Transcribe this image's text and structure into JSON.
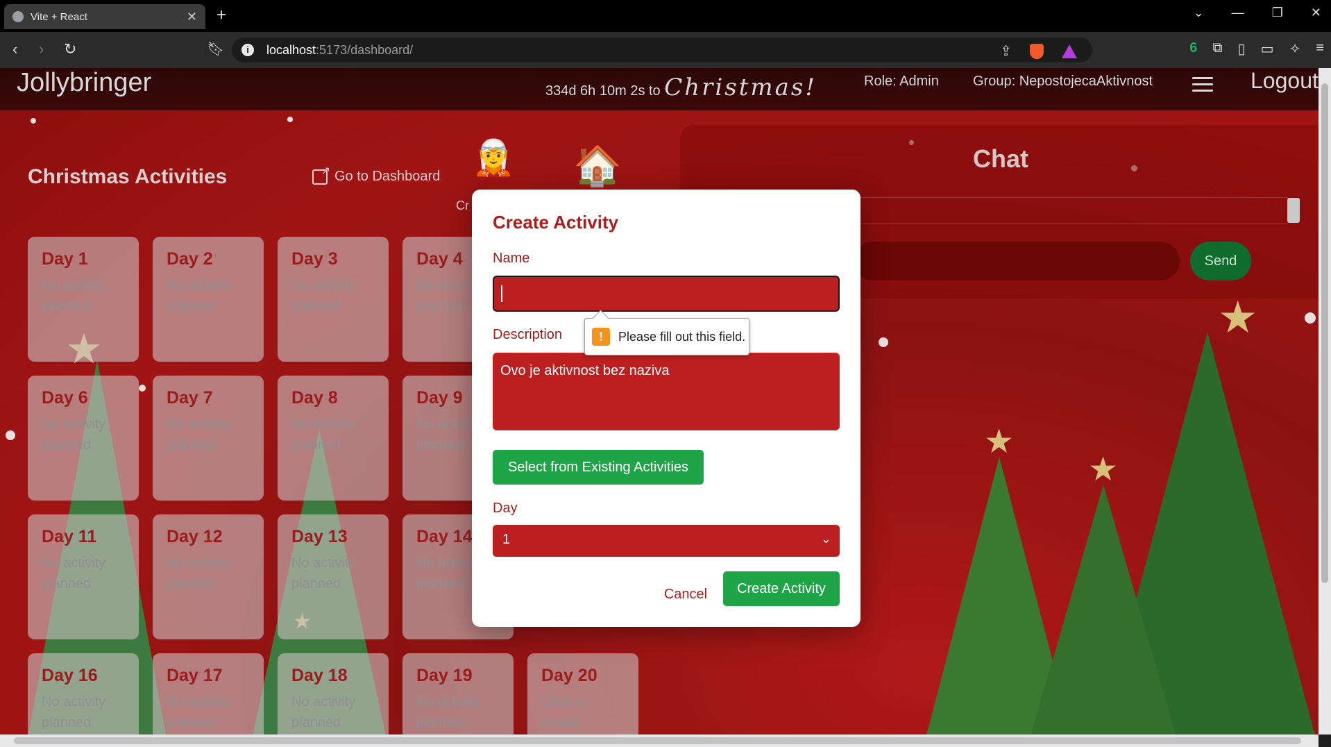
{
  "browser": {
    "tab_title": "Vite + React",
    "url_host": "localhost",
    "url_path": ":5173/dashboard/",
    "extension_badge": "6"
  },
  "navbar": {
    "brand": "Jollybringer",
    "countdown_prefix": "334d 6h 10m 2s to",
    "countdown_word": "Christmas!",
    "role": "Role: Admin",
    "group": "Group: NepostojecaAktivnost",
    "logout": "Logout"
  },
  "activities": {
    "title": "Christmas Activities",
    "goto_dashboard": "Go to Dashboard",
    "cr_fragment": "Cr",
    "days": [
      {
        "day": "Day 1",
        "status": "No activity planned"
      },
      {
        "day": "Day 2",
        "status": "No activity planned"
      },
      {
        "day": "Day 3",
        "status": "No activity planned"
      },
      {
        "day": "Day 4",
        "status": "No activi planned"
      },
      {
        "day": "Day 6",
        "status": "No activity planned"
      },
      {
        "day": "Day 7",
        "status": "No activity planned"
      },
      {
        "day": "Day 8",
        "status": "No activity planned"
      },
      {
        "day": "Day 9",
        "status": "No activi planned"
      },
      {
        "day": "Day 11",
        "status": "No activity planned"
      },
      {
        "day": "Day 12",
        "status": "No activity planned"
      },
      {
        "day": "Day 13",
        "status": "No activity planned"
      },
      {
        "day": "Day 14",
        "status": "No activi planned"
      },
      {
        "day": "Day 16",
        "status": "No activity planned"
      },
      {
        "day": "Day 17",
        "status": "No activity planned"
      },
      {
        "day": "Day 18",
        "status": "No activity planned"
      },
      {
        "day": "Day 19",
        "status": "No activity planned"
      },
      {
        "day": "Day 20",
        "status": "Click to reveal"
      }
    ]
  },
  "chat": {
    "title": "Chat",
    "send_label": "Send"
  },
  "modal": {
    "title": "Create Activity",
    "name_label": "Name",
    "name_value": "",
    "description_label": "Description",
    "description_value": "Ovo je aktivnost bez naziva",
    "select_existing_label": "Select from Existing Activities",
    "day_label": "Day",
    "day_value": "1",
    "cancel_label": "Cancel",
    "create_label": "Create Activity"
  },
  "validation_tooltip": "Please fill out this field.",
  "colors": {
    "primary_red": "#bb1f1f",
    "accent_green": "#1ea548",
    "title_red": "#b01c1c"
  }
}
